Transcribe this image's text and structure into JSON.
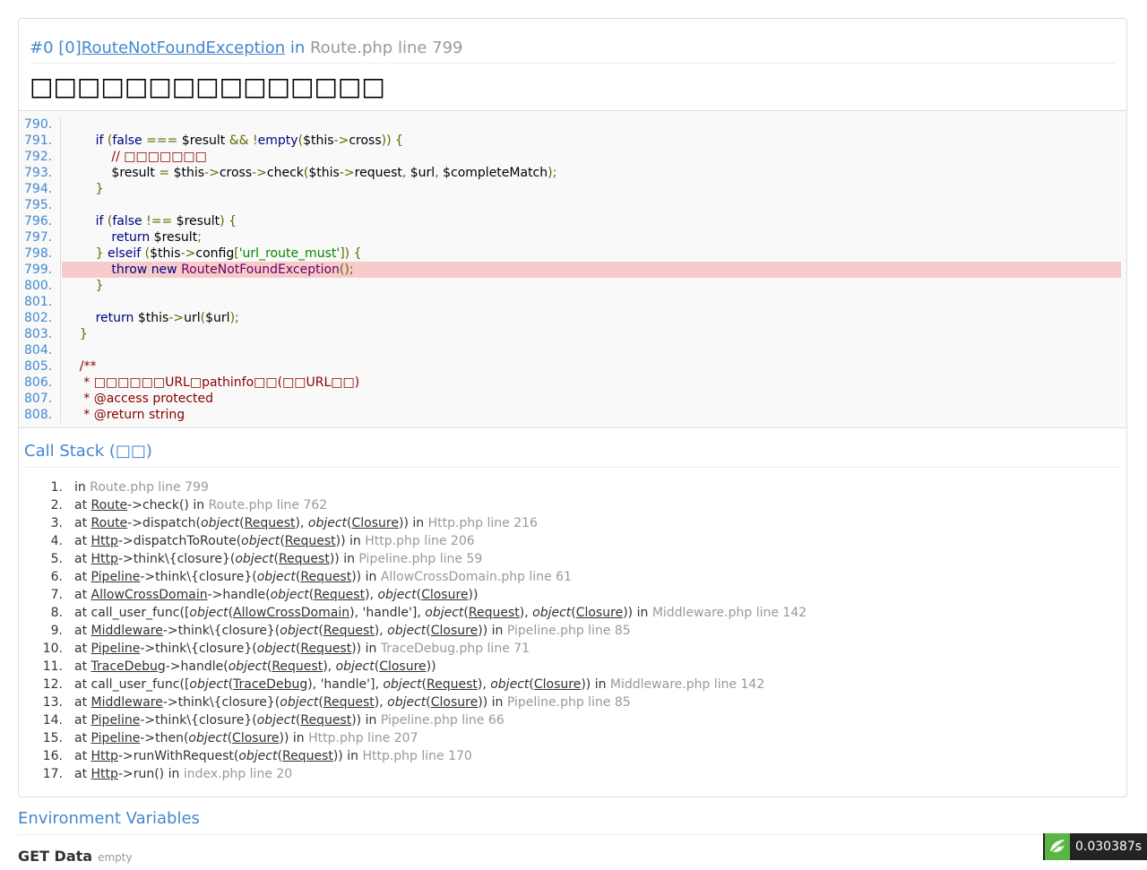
{
  "header": {
    "index": "#0",
    "code_num": "[0]",
    "exception_class": "RouteNotFoundException",
    "in_word": " in ",
    "file_line": "Route.php line 799",
    "message": "□□□□□□□□□□□□□□□"
  },
  "source_lines": [
    {
      "no": "790.",
      "code": ""
    },
    {
      "no": "791.",
      "code": "        if (false === $result && !empty($this->cross)) {"
    },
    {
      "no": "792.",
      "code": "            // □□□□□□□"
    },
    {
      "no": "793.",
      "code": "            $result = $this->cross->check($this->request, $url, $completeMatch);"
    },
    {
      "no": "794.",
      "code": "        }"
    },
    {
      "no": "795.",
      "code": ""
    },
    {
      "no": "796.",
      "code": "        if (false !== $result) {"
    },
    {
      "no": "797.",
      "code": "            return $result;"
    },
    {
      "no": "798.",
      "code": "        } elseif ($this->config['url_route_must']) {"
    },
    {
      "no": "799.",
      "code": "            throw new RouteNotFoundException();",
      "highlight": true
    },
    {
      "no": "800.",
      "code": "        }"
    },
    {
      "no": "801.",
      "code": ""
    },
    {
      "no": "802.",
      "code": "        return $this->url($url);"
    },
    {
      "no": "803.",
      "code": "    }"
    },
    {
      "no": "804.",
      "code": ""
    },
    {
      "no": "805.",
      "code": "    /**"
    },
    {
      "no": "806.",
      "code": "     * □□□□□□URL□pathinfo□□(□□URL□□)"
    },
    {
      "no": "807.",
      "code": "     * @access protected"
    },
    {
      "no": "808.",
      "code": "     * @return string"
    }
  ],
  "call_stack": {
    "title": "Call Stack (□□)",
    "items": [
      {
        "idx": "1.",
        "parts": [
          [
            "t",
            "in "
          ],
          [
            "f",
            "Route.php line 799"
          ]
        ]
      },
      {
        "idx": "2.",
        "parts": [
          [
            "t",
            "at "
          ],
          [
            "u",
            "Route"
          ],
          [
            "t",
            "->check() in "
          ],
          [
            "f",
            "Route.php line 762"
          ]
        ]
      },
      {
        "idx": "3.",
        "parts": [
          [
            "t",
            "at "
          ],
          [
            "u",
            "Route"
          ],
          [
            "t",
            "->dispatch("
          ],
          [
            "i",
            "object"
          ],
          [
            "t",
            "("
          ],
          [
            "u",
            "Request"
          ],
          [
            "t",
            "), "
          ],
          [
            "i",
            "object"
          ],
          [
            "t",
            "("
          ],
          [
            "u",
            "Closure"
          ],
          [
            "t",
            ")) in "
          ],
          [
            "f",
            "Http.php line 216"
          ]
        ]
      },
      {
        "idx": "4.",
        "parts": [
          [
            "t",
            "at "
          ],
          [
            "u",
            "Http"
          ],
          [
            "t",
            "->dispatchToRoute("
          ],
          [
            "i",
            "object"
          ],
          [
            "t",
            "("
          ],
          [
            "u",
            "Request"
          ],
          [
            "t",
            ")) in "
          ],
          [
            "f",
            "Http.php line 206"
          ]
        ]
      },
      {
        "idx": "5.",
        "parts": [
          [
            "t",
            "at "
          ],
          [
            "u",
            "Http"
          ],
          [
            "t",
            "->think\\{closure}("
          ],
          [
            "i",
            "object"
          ],
          [
            "t",
            "("
          ],
          [
            "u",
            "Request"
          ],
          [
            "t",
            ")) in "
          ],
          [
            "f",
            "Pipeline.php line 59"
          ]
        ]
      },
      {
        "idx": "6.",
        "parts": [
          [
            "t",
            "at "
          ],
          [
            "u",
            "Pipeline"
          ],
          [
            "t",
            "->think\\{closure}("
          ],
          [
            "i",
            "object"
          ],
          [
            "t",
            "("
          ],
          [
            "u",
            "Request"
          ],
          [
            "t",
            ")) in "
          ],
          [
            "f",
            "AllowCrossDomain.php line 61"
          ]
        ]
      },
      {
        "idx": "7.",
        "parts": [
          [
            "t",
            "at "
          ],
          [
            "u",
            "AllowCrossDomain"
          ],
          [
            "t",
            "->handle("
          ],
          [
            "i",
            "object"
          ],
          [
            "t",
            "("
          ],
          [
            "u",
            "Request"
          ],
          [
            "t",
            "), "
          ],
          [
            "i",
            "object"
          ],
          [
            "t",
            "("
          ],
          [
            "u",
            "Closure"
          ],
          [
            "t",
            "))"
          ]
        ]
      },
      {
        "idx": "8.",
        "parts": [
          [
            "t",
            "at call_user_func(["
          ],
          [
            "i",
            "object"
          ],
          [
            "t",
            "("
          ],
          [
            "u",
            "AllowCrossDomain"
          ],
          [
            "t",
            "), 'handle'], "
          ],
          [
            "i",
            "object"
          ],
          [
            "t",
            "("
          ],
          [
            "u",
            "Request"
          ],
          [
            "t",
            "), "
          ],
          [
            "i",
            "object"
          ],
          [
            "t",
            "("
          ],
          [
            "u",
            "Closure"
          ],
          [
            "t",
            ")) in "
          ],
          [
            "f",
            "Middleware.php line 142"
          ]
        ]
      },
      {
        "idx": "9.",
        "parts": [
          [
            "t",
            "at "
          ],
          [
            "u",
            "Middleware"
          ],
          [
            "t",
            "->think\\{closure}("
          ],
          [
            "i",
            "object"
          ],
          [
            "t",
            "("
          ],
          [
            "u",
            "Request"
          ],
          [
            "t",
            "), "
          ],
          [
            "i",
            "object"
          ],
          [
            "t",
            "("
          ],
          [
            "u",
            "Closure"
          ],
          [
            "t",
            ")) in "
          ],
          [
            "f",
            "Pipeline.php line 85"
          ]
        ]
      },
      {
        "idx": "10.",
        "parts": [
          [
            "t",
            "at "
          ],
          [
            "u",
            "Pipeline"
          ],
          [
            "t",
            "->think\\{closure}("
          ],
          [
            "i",
            "object"
          ],
          [
            "t",
            "("
          ],
          [
            "u",
            "Request"
          ],
          [
            "t",
            ")) in "
          ],
          [
            "f",
            "TraceDebug.php line 71"
          ]
        ]
      },
      {
        "idx": "11.",
        "parts": [
          [
            "t",
            "at "
          ],
          [
            "u",
            "TraceDebug"
          ],
          [
            "t",
            "->handle("
          ],
          [
            "i",
            "object"
          ],
          [
            "t",
            "("
          ],
          [
            "u",
            "Request"
          ],
          [
            "t",
            "), "
          ],
          [
            "i",
            "object"
          ],
          [
            "t",
            "("
          ],
          [
            "u",
            "Closure"
          ],
          [
            "t",
            "))"
          ]
        ]
      },
      {
        "idx": "12.",
        "parts": [
          [
            "t",
            "at call_user_func(["
          ],
          [
            "i",
            "object"
          ],
          [
            "t",
            "("
          ],
          [
            "u",
            "TraceDebug"
          ],
          [
            "t",
            "), 'handle'], "
          ],
          [
            "i",
            "object"
          ],
          [
            "t",
            "("
          ],
          [
            "u",
            "Request"
          ],
          [
            "t",
            "), "
          ],
          [
            "i",
            "object"
          ],
          [
            "t",
            "("
          ],
          [
            "u",
            "Closure"
          ],
          [
            "t",
            ")) in "
          ],
          [
            "f",
            "Middleware.php line 142"
          ]
        ]
      },
      {
        "idx": "13.",
        "parts": [
          [
            "t",
            "at "
          ],
          [
            "u",
            "Middleware"
          ],
          [
            "t",
            "->think\\{closure}("
          ],
          [
            "i",
            "object"
          ],
          [
            "t",
            "("
          ],
          [
            "u",
            "Request"
          ],
          [
            "t",
            "), "
          ],
          [
            "i",
            "object"
          ],
          [
            "t",
            "("
          ],
          [
            "u",
            "Closure"
          ],
          [
            "t",
            ")) in "
          ],
          [
            "f",
            "Pipeline.php line 85"
          ]
        ]
      },
      {
        "idx": "14.",
        "parts": [
          [
            "t",
            "at "
          ],
          [
            "u",
            "Pipeline"
          ],
          [
            "t",
            "->think\\{closure}("
          ],
          [
            "i",
            "object"
          ],
          [
            "t",
            "("
          ],
          [
            "u",
            "Request"
          ],
          [
            "t",
            ")) in "
          ],
          [
            "f",
            "Pipeline.php line 66"
          ]
        ]
      },
      {
        "idx": "15.",
        "parts": [
          [
            "t",
            "at "
          ],
          [
            "u",
            "Pipeline"
          ],
          [
            "t",
            "->then("
          ],
          [
            "i",
            "object"
          ],
          [
            "t",
            "("
          ],
          [
            "u",
            "Closure"
          ],
          [
            "t",
            ")) in "
          ],
          [
            "f",
            "Http.php line 207"
          ]
        ]
      },
      {
        "idx": "16.",
        "parts": [
          [
            "t",
            "at "
          ],
          [
            "u",
            "Http"
          ],
          [
            "t",
            "->runWithRequest("
          ],
          [
            "i",
            "object"
          ],
          [
            "t",
            "("
          ],
          [
            "u",
            "Request"
          ],
          [
            "t",
            ")) in "
          ],
          [
            "f",
            "Http.php line 170"
          ]
        ]
      },
      {
        "idx": "17.",
        "parts": [
          [
            "t",
            "at "
          ],
          [
            "u",
            "Http"
          ],
          [
            "t",
            "->run() in "
          ],
          [
            "f",
            "index.php line 20"
          ]
        ]
      }
    ]
  },
  "environment": {
    "title": "Environment Variables",
    "get_title": "GET Data",
    "get_note": "empty"
  },
  "trace_badge": {
    "time": "0.030387s",
    "logo_icon": "thinkphp-logo-icon"
  },
  "colors": {
    "accent": "#4288ce",
    "highlight_line": "#f8cbcb"
  }
}
